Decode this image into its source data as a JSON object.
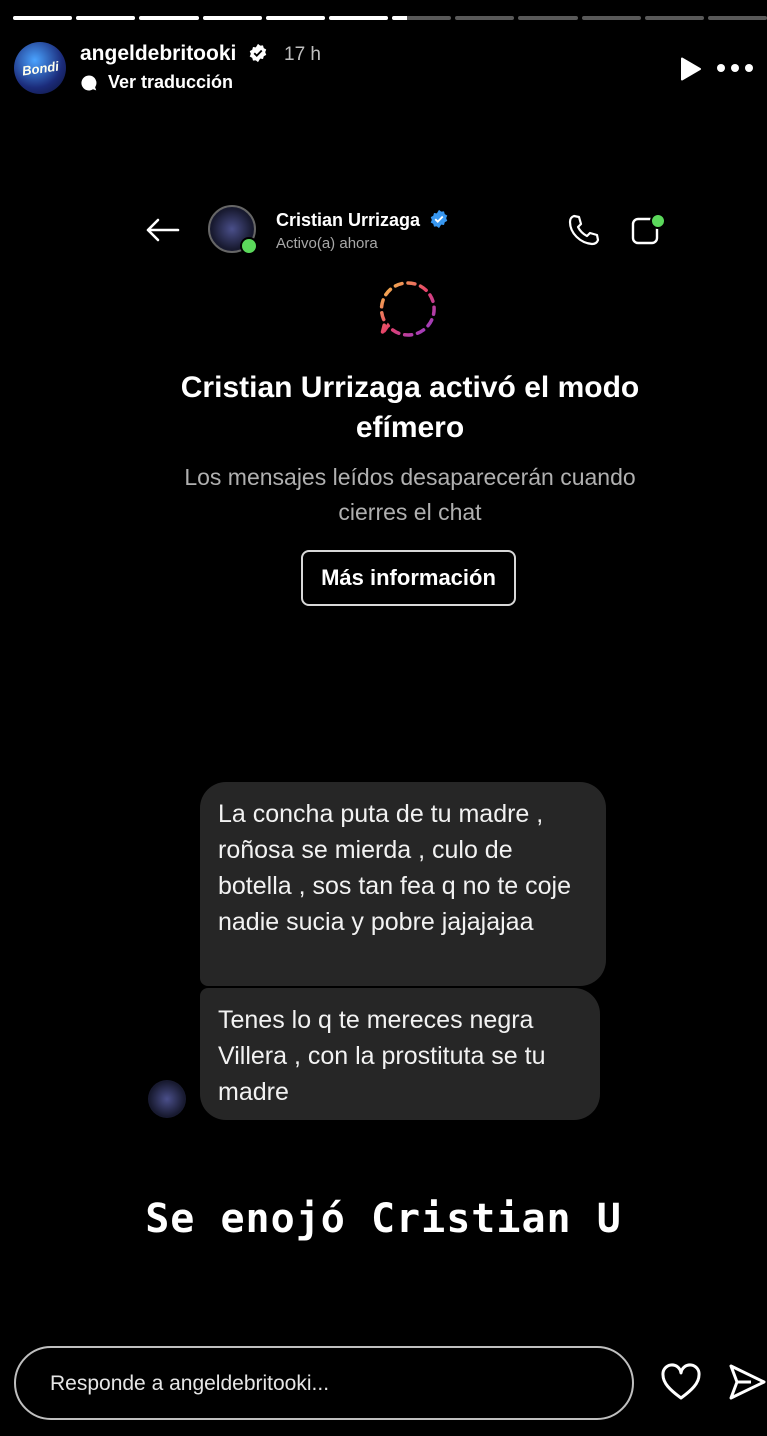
{
  "story": {
    "segments": [
      1,
      1,
      1,
      1,
      1,
      1,
      0.25,
      0,
      0,
      0,
      0,
      0
    ],
    "username": "angeldebritooki",
    "time": "17 h",
    "translate": "Ver traducción",
    "avatar_text": "Bondi"
  },
  "chat": {
    "contact_name": "Cristian Urrizaga",
    "contact_status": "Activo(a) ahora",
    "vanish_title": "Cristian Urrizaga activó el modo efímero",
    "vanish_sub": "Los mensajes leídos desaparecerán cuando cierres el chat",
    "more_info": "Más información",
    "messages": [
      {
        "text": "La concha puta de tu madre , roñosa se mierda , culo de botella , sos tan fea q no te coje nadie sucia y pobre jajajajaa"
      },
      {
        "text": "Tenes lo q te mereces negra Villera , con la prostituta se tu madre"
      }
    ]
  },
  "caption": "Se enojó Cristian U",
  "reply": {
    "placeholder": "Responde a angeldebritooki..."
  },
  "colors": {
    "background": "#000000",
    "bubble": "#262626",
    "verified": "#3897f0",
    "online": "#5bd85b"
  }
}
